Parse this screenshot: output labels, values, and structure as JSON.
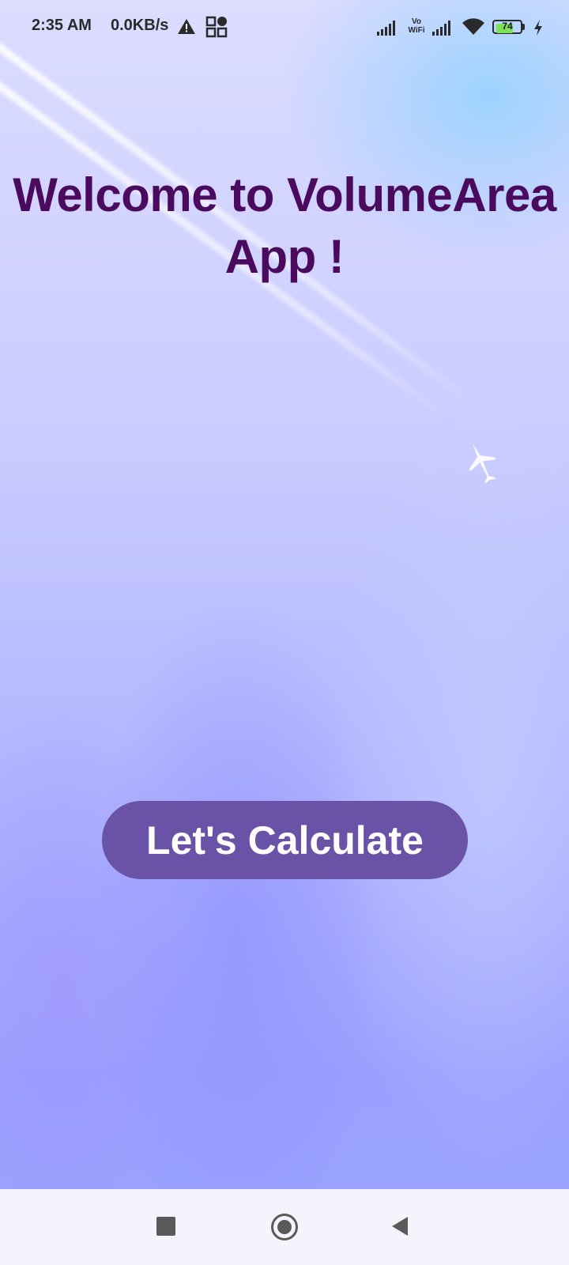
{
  "status_bar": {
    "time": "2:35 AM",
    "network_speed": "0.0KB/s",
    "vowifi_top": "Vo",
    "vowifi_bottom": "WiFi",
    "battery_level": "74",
    "battery_fraction": 0.74,
    "icons": [
      "warning-icon",
      "app-grid-icon",
      "signal-icon",
      "vowifi-icon",
      "signal-icon",
      "wifi-icon",
      "battery-icon",
      "charging-bolt-icon"
    ]
  },
  "main": {
    "title": "Welcome to VolumeArea App !",
    "cta_label": "Let's Calculate"
  },
  "colors": {
    "title": "#4a0a5e",
    "button_bg": "#6a52a6",
    "button_text": "#ffffff",
    "nav_bar_bg": "#f4f4fc"
  },
  "nav_bar": {
    "icons": [
      "recents-icon",
      "home-icon",
      "back-icon"
    ]
  }
}
